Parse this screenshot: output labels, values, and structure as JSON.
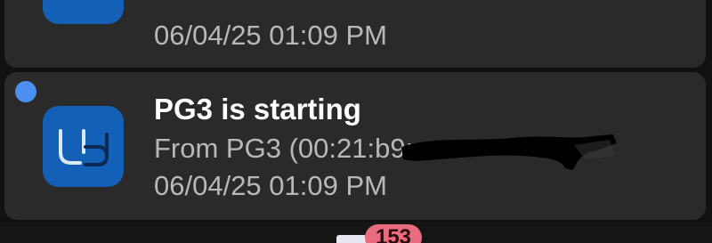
{
  "notifications": [
    {
      "app_icon": "ud-app-icon",
      "timestamp": "06/04/25 01:09 PM"
    },
    {
      "unread": true,
      "app_icon": "ud-app-icon",
      "title": "PG3 is starting",
      "from_text": "From PG3 (00:21:b9:",
      "from_suffix": ")",
      "timestamp": "06/04/25 01:09 PM"
    }
  ],
  "bottom_nav": {
    "badge_count": "153"
  },
  "colors": {
    "background": "#111111",
    "card": "#2a2a2a",
    "icon_blue": "#1560b7",
    "unread_dot": "#4b8ff0",
    "badge": "#e86b7e"
  }
}
